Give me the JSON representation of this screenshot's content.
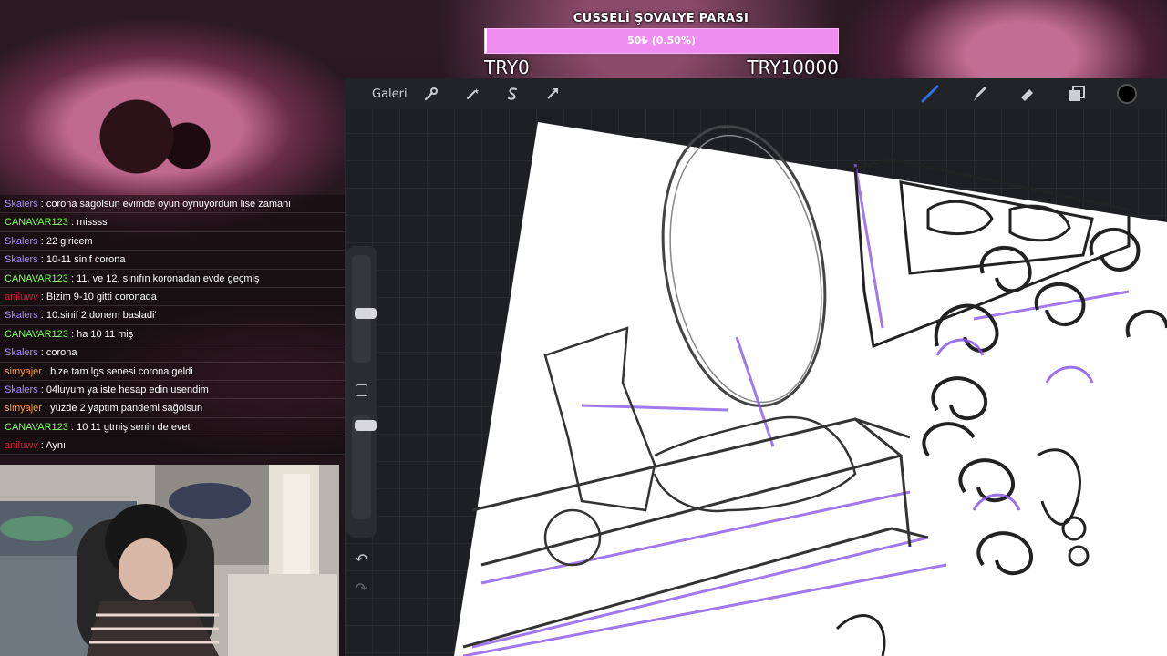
{
  "goal": {
    "title": "CUSSELİ ŞOVALYE PARASI",
    "bar_text": "50₺ (0.50%)",
    "progress_fraction": 0.005,
    "min_label": "TRY0",
    "max_label": "TRY10000",
    "bar_color": "#ef8cf0"
  },
  "toolbar": {
    "gallery_label": "Galeri",
    "left_icons": [
      "wrench-icon",
      "magic-wand-icon",
      "selection-s-icon",
      "transform-arrow-icon"
    ],
    "right_icons": [
      "brush-icon",
      "smudge-icon",
      "eraser-icon",
      "layers-icon",
      "color-swatch-icon"
    ],
    "brush_color": "#2f6fe0",
    "current_color": "#000000"
  },
  "sidebar": {
    "size_slider_value": 0.45,
    "opacity_slider_value": 0.05,
    "undo_icon": "↶",
    "redo_icon": "↷"
  },
  "chat": {
    "messages": [
      {
        "user": "Skalers",
        "color": "#a98bff",
        "text": "corona sagolsun evimde oyun oynuyordum lise zamani"
      },
      {
        "user": "CANAVAR123",
        "color": "#7cff5a",
        "text": "missss"
      },
      {
        "user": "Skalers",
        "color": "#a98bff",
        "text": "22 giricem"
      },
      {
        "user": "Skalers",
        "color": "#a98bff",
        "text": "10-11 sinif corona"
      },
      {
        "user": "CANAVAR123",
        "color": "#7cff5a",
        "text": "11. ve 12. sınıfın koronadan evde geçmiş"
      },
      {
        "user": "aniluwv",
        "color": "#d11b3a",
        "text": "Bizim 9-10 gitti coronada"
      },
      {
        "user": "Skalers",
        "color": "#a98bff",
        "text": "10.sinif 2.donem basladi'"
      },
      {
        "user": "CANAVAR123",
        "color": "#7cff5a",
        "text": "ha 10 11 miş"
      },
      {
        "user": "Skalers",
        "color": "#a98bff",
        "text": "corona"
      },
      {
        "user": "simyajer",
        "color": "#ff9a3c",
        "text": "bize tam lgs senesi corona geldi"
      },
      {
        "user": "Skalers",
        "color": "#a98bff",
        "text": "04luyum ya iste hesap edin usendim"
      },
      {
        "user": "simyajer",
        "color": "#ff9a3c",
        "text": "yüzde 2 yaptım pandemi sağolsun"
      },
      {
        "user": "CANAVAR123",
        "color": "#7cff5a",
        "text": "10 11 gtmiş senin de evet"
      },
      {
        "user": "aniluwv",
        "color": "#d11b3a",
        "text": "Aynı"
      }
    ]
  }
}
